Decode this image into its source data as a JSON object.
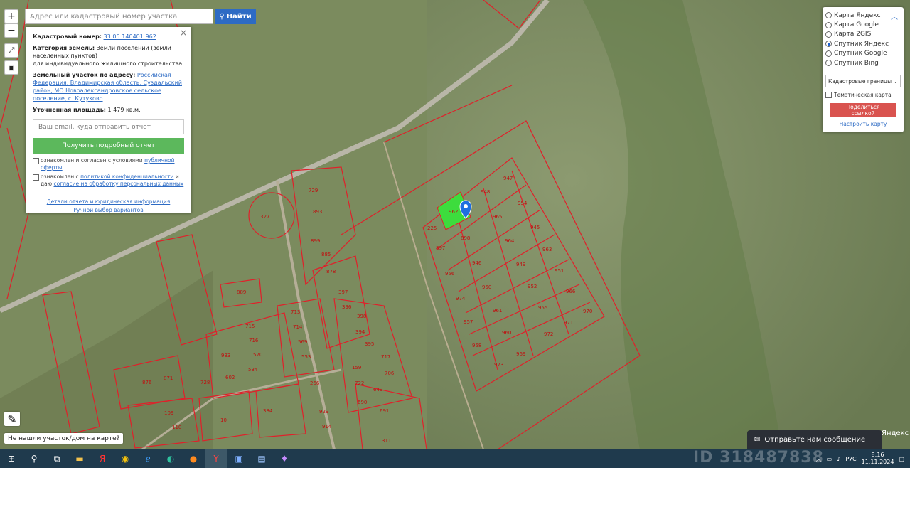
{
  "search": {
    "placeholder": "Адрес или кадастровый номер участка",
    "button_label": "Найти"
  },
  "zoom": {
    "plus": "+",
    "minus": "−"
  },
  "info_panel": {
    "close": "×",
    "cad_label": "Кадастровый номер:",
    "cad_value": "33:05:140401:962",
    "category_label": "Категория земель:",
    "category_value": "Земли поселений (земли населенных пунктов)",
    "category_sub": "для индивидуального жилищного строительства",
    "address_label": "Земельный участок по адресу:",
    "address_value": "Российская Федерация, Владимирская область, Суздальский район, МО Новоалександровское сельское поселение, с. Кутуково",
    "area_label": "Уточненная площадь:",
    "area_value": "1 479 кв.м.",
    "email_placeholder": "Ваш email, куда отправить отчет",
    "report_button": "Получить подробный отчет",
    "consent1_text": "ознакомлен и согласен с условиями",
    "consent1_link": "публичной оферты",
    "consent2_text": "ознакомлен с",
    "consent2_link": "политикой конфиденциальности",
    "consent2_text2": "и даю",
    "consent2_link2": "согласие на обработку персональных данных",
    "link_details": "Детали отчета и юридическая информация",
    "link_manual": "Ручной выбор вариантов"
  },
  "layers_panel": {
    "options": [
      {
        "label": "Карта Яндекс",
        "selected": false
      },
      {
        "label": "Карта Google",
        "selected": false
      },
      {
        "label": "Карта 2GIS",
        "selected": false
      },
      {
        "label": "Спутник Яндекс",
        "selected": true
      },
      {
        "label": "Спутник Google",
        "selected": false
      },
      {
        "label": "Спутник Bing",
        "selected": false
      }
    ],
    "select_value": "Кадастровые границы",
    "thematic_label": "Тематическая карта",
    "share_button": "Поделиться ссылкой",
    "configure_link": "Настроить карту"
  },
  "not_found_button": "Не нашли участок/дом на карте?",
  "chat_label": "Отправьте нам сообщение",
  "yandex_mark": "Яндекс",
  "watermark": "ID 318487838",
  "parcel_labels": [
    "948",
    "947",
    "954",
    "965",
    "945",
    "964",
    "963",
    "949",
    "951",
    "952",
    "966",
    "955",
    "970",
    "971",
    "972",
    "969",
    "973",
    "960",
    "958",
    "961",
    "957",
    "950",
    "974",
    "946",
    "956",
    "898",
    "897",
    "225",
    "962",
    "729",
    "893",
    "899",
    "885",
    "878",
    "397",
    "396",
    "398",
    "394",
    "395",
    "717",
    "706",
    "722",
    "690",
    "691",
    "713",
    "714",
    "569",
    "553",
    "715",
    "716",
    "570",
    "933",
    "534",
    "602",
    "728",
    "876",
    "871",
    "109",
    "110",
    "10",
    "384",
    "929",
    "914",
    "311",
    "266",
    "327",
    "889",
    "649",
    "159"
  ],
  "taskbar": {
    "language": "РУС",
    "time": "8:16",
    "date": "11.11.2024"
  },
  "colors": {
    "parcel_border": "#e0202a",
    "selected_parcel": "#3ddc3d",
    "pin": "#1f6fe0",
    "taskbar": "#1f3a4d"
  }
}
